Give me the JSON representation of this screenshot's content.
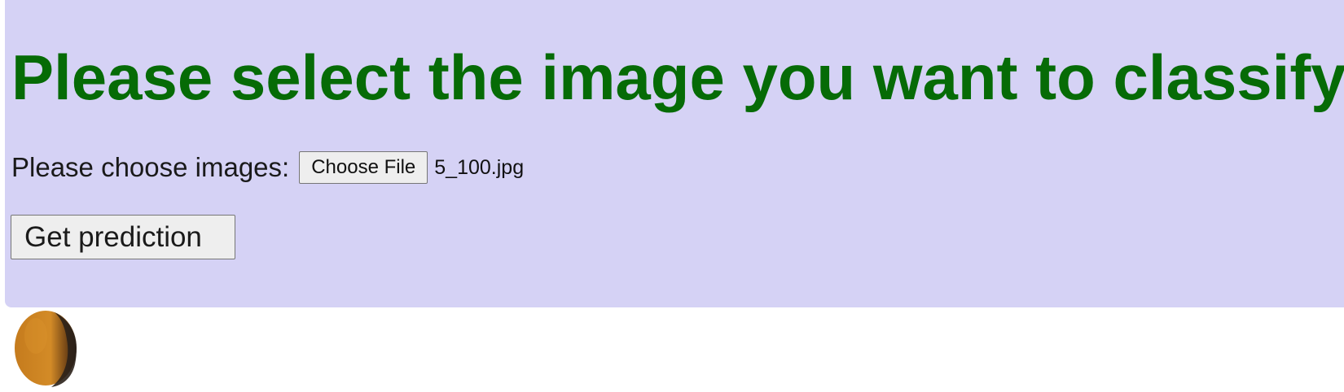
{
  "page": {
    "title": "Please select the image you want to classify:"
  },
  "upload": {
    "label": "Please choose images:",
    "button_label": "Choose File",
    "selected_file": "5_100.jpg"
  },
  "actions": {
    "prediction_label": "Get prediction"
  },
  "preview": {
    "alt": "5_100.jpg"
  },
  "colors": {
    "panel_background": "#d5d2f5",
    "title_text": "#066b06",
    "button_background": "#eeeeee",
    "preview_object": "#d28a26"
  }
}
